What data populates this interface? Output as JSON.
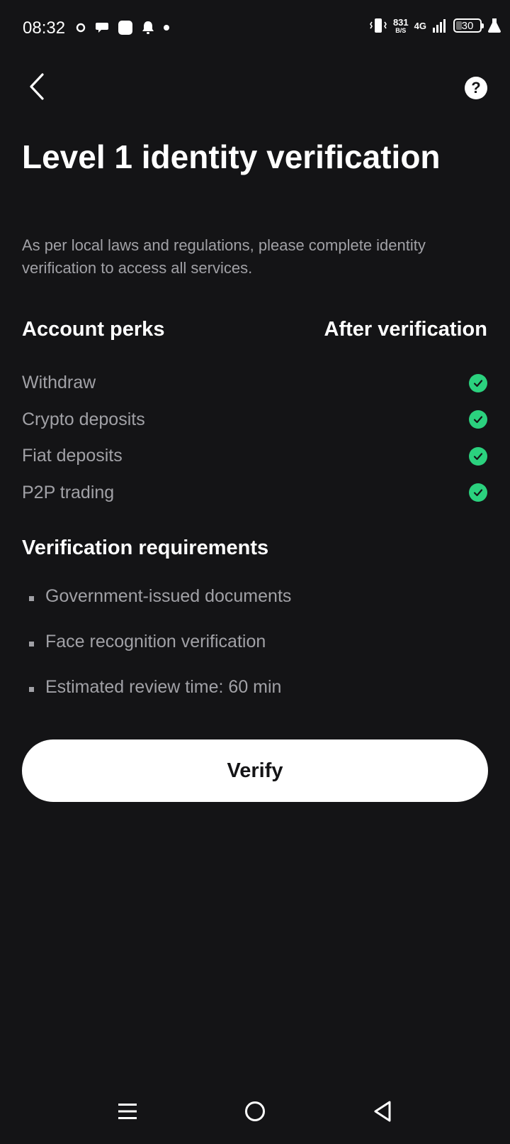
{
  "status_bar": {
    "time": "08:32",
    "net_speed": "831",
    "net_speed_unit": "B/S",
    "network_type": "4G",
    "battery_level": "30"
  },
  "header": {
    "back_icon": "chevron-left-icon",
    "help_icon": "question-mark-icon",
    "help_label": "?"
  },
  "title": "Level 1 identity verification",
  "subtitle": "As per local laws and regulations, please complete identity verification to access all services.",
  "perks": {
    "column_left": "Account perks",
    "column_right": "After verification",
    "items": [
      {
        "label": "Withdraw",
        "status": "check-icon"
      },
      {
        "label": "Crypto deposits",
        "status": "check-icon"
      },
      {
        "label": "Fiat deposits",
        "status": "check-icon"
      },
      {
        "label": "P2P trading",
        "status": "check-icon"
      }
    ],
    "check_color": "#2bd17e"
  },
  "requirements": {
    "title": "Verification requirements",
    "items": [
      "Government-issued documents",
      "Face recognition verification",
      "Estimated review time: 60 min"
    ]
  },
  "verify_button": {
    "label": "Verify"
  },
  "nav_bar": {
    "menu_icon": "menu-icon",
    "home_icon": "home-circle-icon",
    "back_icon": "back-triangle-icon"
  },
  "colors": {
    "background": "#141416",
    "primary_text": "#ffffff",
    "secondary_text": "#a1a1a6",
    "accent_green": "#2bd17e"
  }
}
